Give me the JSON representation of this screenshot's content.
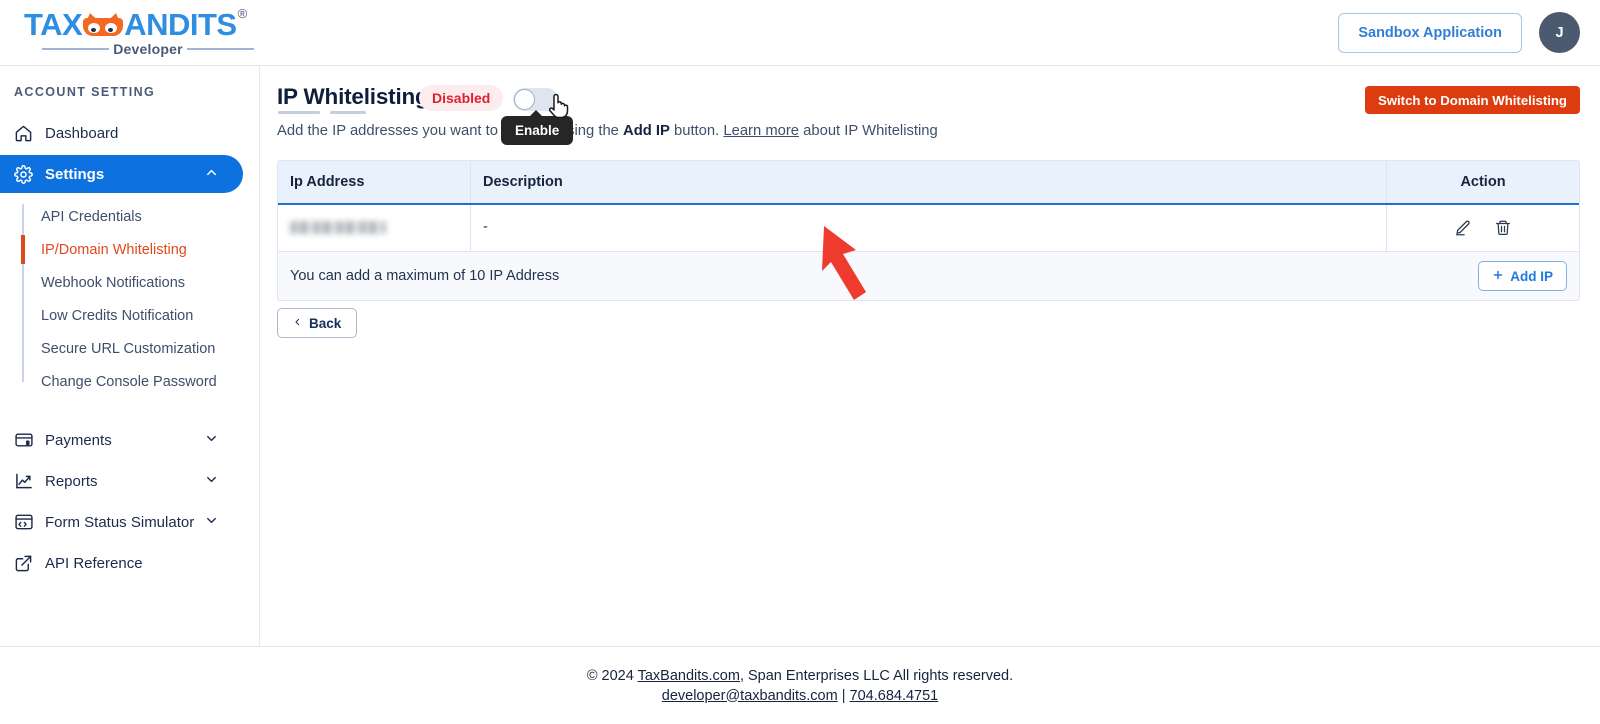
{
  "header": {
    "logo": {
      "part1": "TAX",
      "part2": "ANDITS",
      "registered": "®",
      "subtitle": "Developer",
      "mask_icon": "bandit-mask-icon"
    },
    "sandbox_button": "Sandbox Application",
    "avatar_initial": "J"
  },
  "sidebar": {
    "section_title": "ACCOUNT SETTING",
    "items": [
      {
        "label": "Dashboard",
        "icon": "home-icon",
        "active": false,
        "expandable": false
      },
      {
        "label": "Settings",
        "icon": "gear-icon",
        "active": true,
        "expandable": true,
        "chevron": "chevron-up-icon"
      },
      {
        "label": "Payments",
        "icon": "card-dollar-icon",
        "active": false,
        "expandable": true,
        "chevron": "chevron-down-icon"
      },
      {
        "label": "Reports",
        "icon": "trend-chart-icon",
        "active": false,
        "expandable": true,
        "chevron": "chevron-down-icon"
      },
      {
        "label": "Form Status Simulator",
        "icon": "browser-code-icon",
        "active": false,
        "expandable": true,
        "chevron": "chevron-down-icon"
      },
      {
        "label": "API Reference",
        "icon": "external-link-icon",
        "active": false,
        "expandable": false
      }
    ],
    "sub_items": [
      {
        "label": "API Credentials",
        "active": false
      },
      {
        "label": "IP/Domain Whitelisting",
        "active": true
      },
      {
        "label": "Webhook Notifications",
        "active": false
      },
      {
        "label": "Low Credits Notification",
        "active": false
      },
      {
        "label": "Secure URL Customization",
        "active": false
      },
      {
        "label": "Change Console Password",
        "active": false
      }
    ]
  },
  "main": {
    "title": "IP Whitelisting",
    "status_badge": "Disabled",
    "toggle_state": "off",
    "tooltip": "Enable",
    "switch_button": "Switch to Domain Whitelisting",
    "subtitle": {
      "text_1": "Add the IP addresses you want to whitelist using the ",
      "bold": "Add IP",
      "text_2": " button. ",
      "link": "Learn more",
      "text_3": " about IP Whitelisting"
    },
    "table": {
      "columns": [
        "Ip Address",
        "Description",
        "Action"
      ],
      "rows": [
        {
          "ip_address": "",
          "ip_redacted": true,
          "description": "-",
          "actions": [
            "edit-icon",
            "delete-icon"
          ]
        }
      ],
      "footer_message": "You can add a maximum of 10 IP Address",
      "add_button": "Add IP",
      "add_button_icon": "plus-icon"
    },
    "back_button": "Back",
    "back_button_icon": "chevron-left-icon",
    "annotation": "red-arrow-annotation"
  },
  "footer": {
    "line1_prefix": "© 2024 ",
    "line1_link": "TaxBandits.com",
    "line1_suffix": ", Span Enterprises LLC All rights reserved.",
    "email": "developer@taxbandits.com",
    "separator": " | ",
    "phone": "704.684.4751"
  },
  "colors": {
    "brand_blue": "#2f8ee0",
    "brand_orange": "#f26a21",
    "active_nav": "#0d72e0",
    "active_sub": "#e1491d",
    "danger_badge_text": "#e02030",
    "danger_badge_bg": "#fdeced",
    "switch_button_bg": "#dd3c10",
    "table_head_bg": "#e9f2fc",
    "annotation_red": "#ef3b2d"
  }
}
